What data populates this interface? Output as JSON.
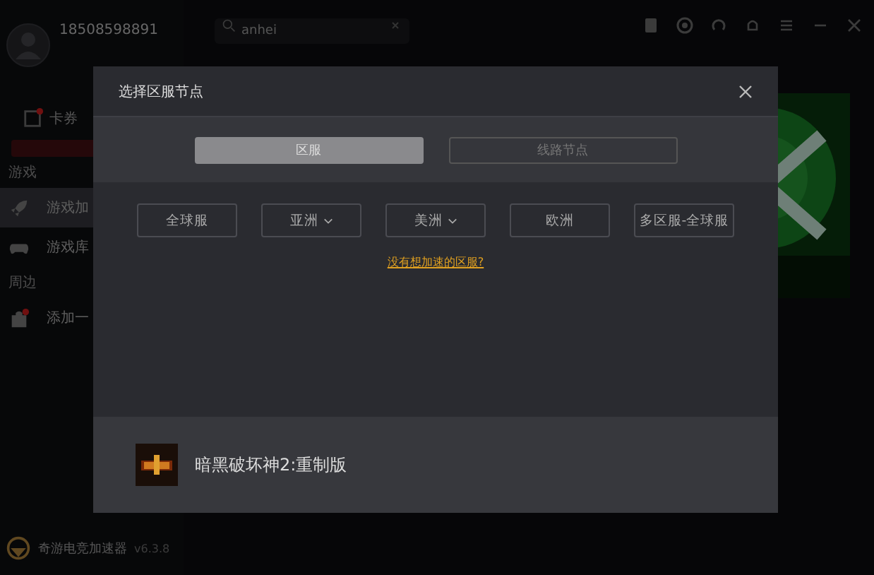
{
  "app": {
    "user": {
      "phone": "18508598891"
    },
    "sidebar": {
      "coupon": {
        "label": "卡券",
        "has_dot": true
      },
      "sections": [
        {
          "title": "游戏",
          "items": [
            {
              "label": "游戏加",
              "kind": "rocket",
              "selected": true,
              "has_dot": false
            },
            {
              "label": "游戏库",
              "kind": "gamepad",
              "selected": false,
              "has_dot": false
            }
          ]
        },
        {
          "title": "周边",
          "items": [
            {
              "label": "添加一",
              "kind": "bag",
              "selected": false,
              "has_dot": true
            }
          ]
        }
      ]
    },
    "brand": {
      "name": "奇游电竞加速器",
      "version": "v6.3.8"
    },
    "search": {
      "value": "anhei"
    }
  },
  "dialog": {
    "title": "选择区服节点",
    "tabs": [
      {
        "label": "区服",
        "selected": true
      },
      {
        "label": "线路节点",
        "selected": false
      }
    ],
    "regions": [
      {
        "label": "全球服",
        "dropdown": false
      },
      {
        "label": "亚洲",
        "dropdown": true
      },
      {
        "label": "美洲",
        "dropdown": true
      },
      {
        "label": "欧洲",
        "dropdown": false
      },
      {
        "label": "多区服-全球服",
        "dropdown": false
      }
    ],
    "link": "没有想加速的区服?",
    "game": {
      "name": "暗黑破坏神2:重制版"
    }
  }
}
